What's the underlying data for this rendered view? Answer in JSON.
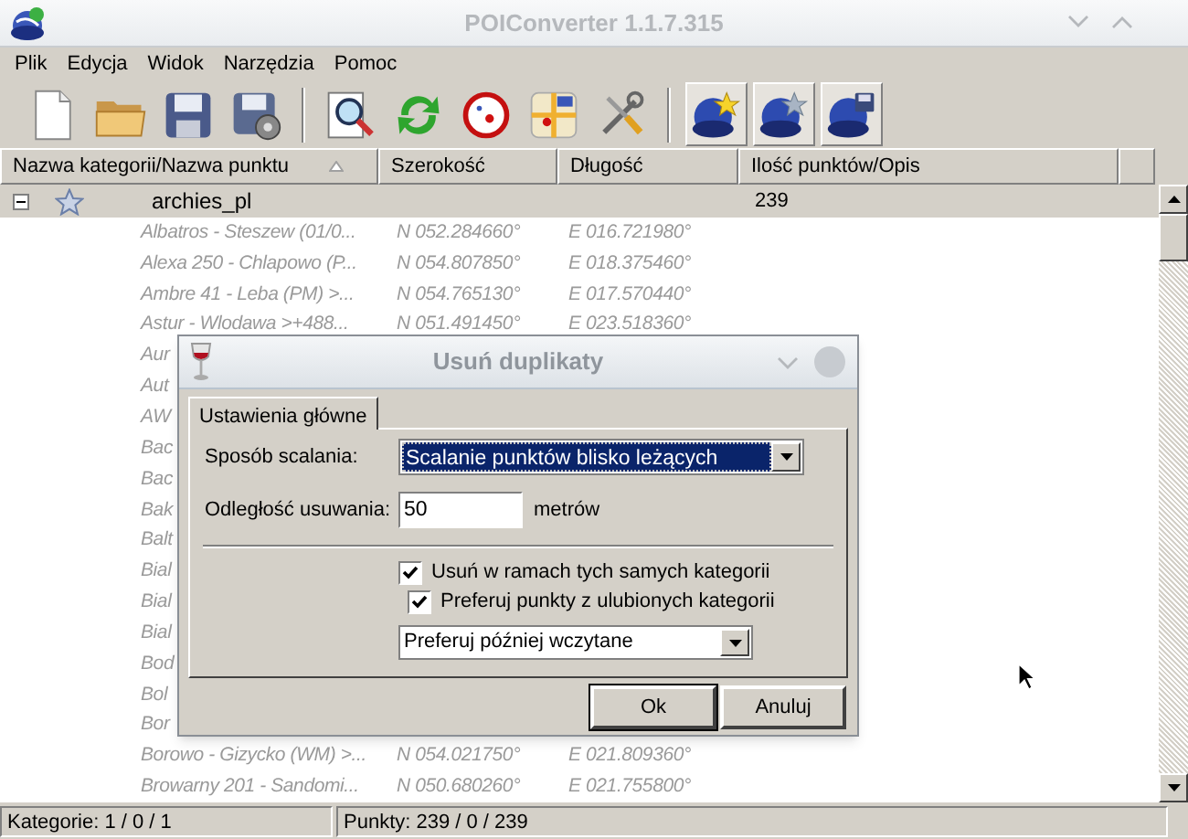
{
  "window": {
    "title": "POIConverter 1.1.7.315"
  },
  "menu": [
    "Plik",
    "Edycja",
    "Widok",
    "Narzędzia",
    "Pomoc"
  ],
  "toolbar": [
    {
      "kind": "new",
      "pressed": false
    },
    {
      "kind": "open",
      "pressed": false
    },
    {
      "kind": "save",
      "pressed": false
    },
    {
      "kind": "savesettings",
      "pressed": false
    },
    {
      "kind": "sep"
    },
    {
      "kind": "search",
      "pressed": false
    },
    {
      "kind": "refresh",
      "pressed": false
    },
    {
      "kind": "target",
      "pressed": false
    },
    {
      "kind": "map",
      "pressed": false
    },
    {
      "kind": "tools",
      "pressed": false
    },
    {
      "kind": "sep"
    },
    {
      "kind": "globestar",
      "pressed": true
    },
    {
      "kind": "globestargrey",
      "pressed": true
    },
    {
      "kind": "globedisk",
      "pressed": true
    }
  ],
  "table": {
    "columns": [
      "Nazwa kategorii/Nazwa punktu",
      "Szerokość",
      "Długość",
      "Ilość punktów/Opis"
    ],
    "category": {
      "name": "archies_pl",
      "count": "239",
      "expanded": true
    },
    "rows": [
      {
        "name": "Albatros - Steszew (01/0...",
        "latitude": "N 052.284660°",
        "longitude": "E 016.721980°"
      },
      {
        "name": "Alexa 250 - Chlapowo (P...",
        "latitude": "N 054.807850°",
        "longitude": "E 018.375460°"
      },
      {
        "name": "Ambre 41 - Leba (PM) >...",
        "latitude": "N 054.765130°",
        "longitude": "E 017.570440°"
      },
      {
        "name": "Astur - Wlodawa >+488...",
        "latitude": "N 051.491450°",
        "longitude": "E 023.518360°"
      },
      {
        "name": "Aur"
      },
      {
        "name": "Aut"
      },
      {
        "name": "AW"
      },
      {
        "name": "Bac"
      },
      {
        "name": "Bac"
      },
      {
        "name": "Bak"
      },
      {
        "name": "Balt"
      },
      {
        "name": "Bial"
      },
      {
        "name": "Bial"
      },
      {
        "name": "Bial"
      },
      {
        "name": "Bod"
      },
      {
        "name": "Bol"
      },
      {
        "name": "Bor"
      },
      {
        "name": "Borowo - Gizycko (WM) >...",
        "latitude": "N 054.021750°",
        "longitude": "E 021.809360°"
      },
      {
        "name": "Browarny 201 - Sandomi...",
        "latitude": "N 050.680260°",
        "longitude": "E 021.755800°"
      }
    ]
  },
  "status_bar": [
    "Kategorie: 1 / 0 / 1",
    "Punkty: 239 / 0 / 239"
  ],
  "dialog": {
    "title": "Usuń duplikaty",
    "tabs": [
      {
        "label": "Ustawienia główne",
        "selected": true
      }
    ],
    "merge_method": {
      "label": "Sposób scalania:",
      "value": "Scalanie punktów blisko leżących"
    },
    "distance": {
      "label": "Odległość usuwania:",
      "value": "50",
      "unit": "metrów"
    },
    "checkboxes": [
      {
        "label": "Usuń w ramach tych samych kategorii",
        "checked": true
      },
      {
        "label": "Preferuj punkty z ulubionych kategorii",
        "checked": true
      }
    ],
    "preference": {
      "value": "Preferuj później wczytane"
    },
    "buttons": [
      {
        "label": "Ok",
        "default": true
      },
      {
        "label": "Anuluj",
        "default": false
      }
    ]
  }
}
